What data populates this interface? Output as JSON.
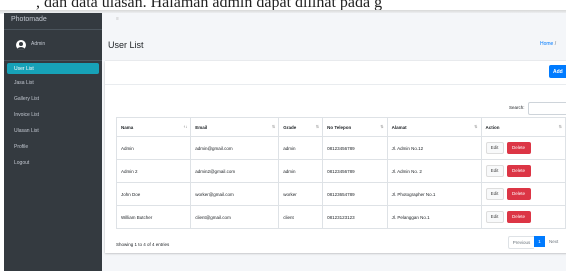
{
  "top_overlay_text": ", dan data ulasan. Halaman admin dapat dilihat pada g",
  "sidebar": {
    "brand": "Photomade",
    "user_name": "Admin",
    "items": [
      {
        "label": "User List",
        "active": true
      },
      {
        "label": "Jasa List",
        "active": false
      },
      {
        "label": "Gallery List",
        "active": false
      },
      {
        "label": "Invoice List",
        "active": false
      },
      {
        "label": "Ulasan List",
        "active": false
      },
      {
        "label": "Profile",
        "active": false
      },
      {
        "label": "Logout",
        "active": false
      }
    ]
  },
  "header": {
    "collapse_icon": "≡",
    "title": "User List",
    "breadcrumb": {
      "home": "Home",
      "sep": "/"
    }
  },
  "toolbar": {
    "add_label": "Add"
  },
  "search": {
    "label": "Search:",
    "placeholder": ""
  },
  "table": {
    "columns": [
      "Nama",
      "Email",
      "Grade",
      "No Telepon",
      "Alamat",
      "Action"
    ],
    "sort_icons": [
      "↑↓",
      "⇅",
      "⇅",
      "⇅",
      "⇅",
      "⇅"
    ],
    "rows": [
      {
        "nama": "Admin",
        "email": "admin@gmail.com",
        "grade": "admin",
        "telepon": "08123456789",
        "alamat": "Jl. Admin No.12"
      },
      {
        "nama": "Admin 2",
        "email": "admin2@gmail.com",
        "grade": "admin",
        "telepon": "08123456789",
        "alamat": "Jl. Admin No. 2"
      },
      {
        "nama": "John Doe",
        "email": "worker@gmail.com",
        "grade": "worker",
        "telepon": "08123654789",
        "alamat": "Jl. Photographer No.1"
      },
      {
        "nama": "William Butcher",
        "email": "client@gmail.com",
        "grade": "client",
        "telepon": "08123123123",
        "alamat": "Jl. Pelanggan No.1"
      }
    ],
    "edit_label": "Edit",
    "delete_label": "Delete"
  },
  "footer": {
    "info": "Showing 1 to 4 of 4 entries"
  },
  "pagination": {
    "previous": "Previous",
    "current": "1",
    "next": "Next"
  },
  "colors": {
    "sidebar_bg": "#343a40",
    "active_item": "#17a2b8",
    "primary": "#007bff",
    "danger": "#dc3545",
    "content_bg": "#f4f6f9"
  }
}
